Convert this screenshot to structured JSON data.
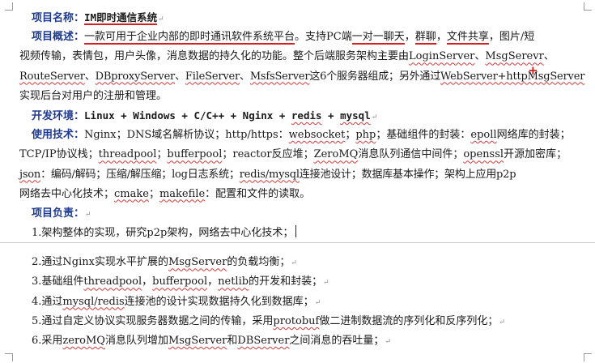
{
  "title_label": "项目名称：",
  "title_value": "IM即时通信系统",
  "overview_label": "项目概述：",
  "overview_hl1": "一款可用于企业内部的即时通讯软件系统平台",
  "overview_sep1": "。支持",
  "overview_pc": "PC",
  "overview_mid": "端",
  "overview_hl2": "一对一聊天",
  "overview_comma1": "，",
  "overview_hl3": "群聊",
  "overview_comma2": "，",
  "overview_hl4": "文件共享",
  "overview_rest1": "，图片/短",
  "overview_line2": "视频传输，表情包，用户头像，消息数据的持久化的功能。整个后端服务架构主要由",
  "srv_login": "LoginServer",
  "sep_dun": "、",
  "srv_msg": "MsgSerevr",
  "srv_route": "RouteServer",
  "srv_dbproxy": "DBproxyServer",
  "srv_file": "FileServer",
  "srv_msfs": "MsfsServer",
  "overview_line3_tail": "这6个服务器组成；另外通过",
  "srv_web": "WebServer+httpMsgServer",
  "overview_line4": "实现后台对用户的注册和管理。",
  "env_label": "开发环境：",
  "env_value_a": "Linux + Windows + C/C++ + Nginx + ",
  "env_redis": "redis",
  "env_plus": " + ",
  "env_mysql": "mysql",
  "tech_label": "使用技术：",
  "tech_l1_a": "Nginx；DNS域名解析协议；http/https：",
  "tech_websocket": "websocket",
  "tech_l1_b": "；",
  "tech_php": "php",
  "tech_l1_c": "；基础组件的封装：",
  "tech_epoll": "epoll",
  "tech_l1_d": "网络库的封装；",
  "tech_l2_a": "TCP/IP协议栈；",
  "tech_threadpool": "threadpool",
  "tech_l2_b": "；",
  "tech_bufferpool": "bufferpool",
  "tech_l2_c": "；reactor反应堆；",
  "tech_zeromq": "ZeroMQ",
  "tech_l2_d": "消息队列通信中间件；",
  "tech_openssl": "openssl",
  "tech_l2_e": "开源加密库；",
  "tech_json": "json",
  "tech_l3_a": "：编码/解码；压缩/解压缩；log日志系统；",
  "tech_redismysql": "redis/mysql",
  "tech_l3_b": "连接池设计；数据库基本操作；架构上应用p2p",
  "tech_l4_a": "网络去中心化技术；",
  "tech_cmake": "cmake",
  "tech_l4_b": "；",
  "tech_makefile": "makefile",
  "tech_l4_c": "：配置和文件的读取。",
  "duty_label": "项目负责：",
  "duty_1": "1.架构整体的实现，研究p2p架构，网络去中心化技术；",
  "duty_2a": "2.通过Nginx实现水平扩展的",
  "duty_2_msg": "MsgServer",
  "duty_2b": "的负载均衡；",
  "duty_3a": "3.基础组件",
  "duty_3_tp": "threadpool",
  "duty_3_sep": "，",
  "duty_3_bp": "bufferpool",
  "duty_3_net": "netlib",
  "duty_3b": "的开发和封装；",
  "duty_4a": "4.通过",
  "duty_4_mr": "mysql/redis",
  "duty_4b": "连接池的设计实现数据持久化到数据库；",
  "duty_5a": "5.通过自定义协议实现服务器数据之间的传输，采用",
  "duty_5_pb": "protobuf",
  "duty_5b": "做二进制数据流的序列化和反序列化；",
  "duty_6a": "6.采用",
  "duty_6_zmq": "zeroMQ",
  "duty_6b": "消息队列增加",
  "duty_6_msg": "MsgServer",
  "duty_6c": "和",
  "duty_6_db": "DBServer",
  "duty_6d": "之间消息的吞吐量；",
  "para_mark": "↵",
  "plus_mark": "+",
  "accent_color": "#1f3b8f",
  "annotation_color": "#d42020"
}
